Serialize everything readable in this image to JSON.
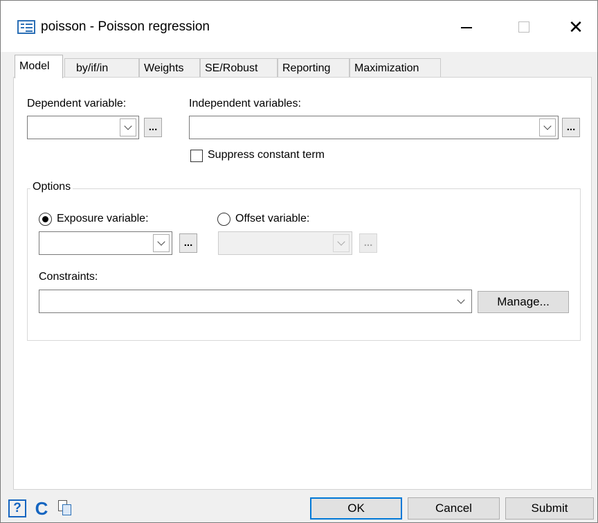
{
  "window": {
    "title": "poisson - Poisson regression",
    "close_glyph": "✕"
  },
  "tabs": [
    {
      "label": "Model",
      "active": true
    },
    {
      "label": "by/if/in",
      "active": false
    },
    {
      "label": "Weights",
      "active": false
    },
    {
      "label": "SE/Robust",
      "active": false
    },
    {
      "label": "Reporting",
      "active": false
    },
    {
      "label": "Maximization",
      "active": false
    }
  ],
  "model": {
    "dependent_label": "Dependent variable:",
    "dependent_value": "",
    "independent_label": "Independent variables:",
    "independent_value": "",
    "browse_label": "...",
    "suppress_constant_label": "Suppress constant term",
    "suppress_constant_checked": false
  },
  "options": {
    "group_title": "Options",
    "exposure_label": "Exposure variable:",
    "exposure_selected": true,
    "exposure_value": "",
    "offset_label": "Offset variable:",
    "offset_selected": false,
    "offset_value": "",
    "constraints_label": "Constraints:",
    "constraints_value": "",
    "manage_label": "Manage..."
  },
  "footer": {
    "help_glyph": "?",
    "reset_glyph": "C",
    "ok_label": "OK",
    "cancel_label": "Cancel",
    "submit_label": "Submit"
  },
  "colors": {
    "accent": "#0078d7",
    "icon_blue": "#1565c0"
  },
  "icons": [
    "app-icon",
    "minimize-icon",
    "maximize-icon",
    "close-icon",
    "chevron-down-icon",
    "help-icon",
    "reset-icon",
    "copy-command-icon"
  ]
}
